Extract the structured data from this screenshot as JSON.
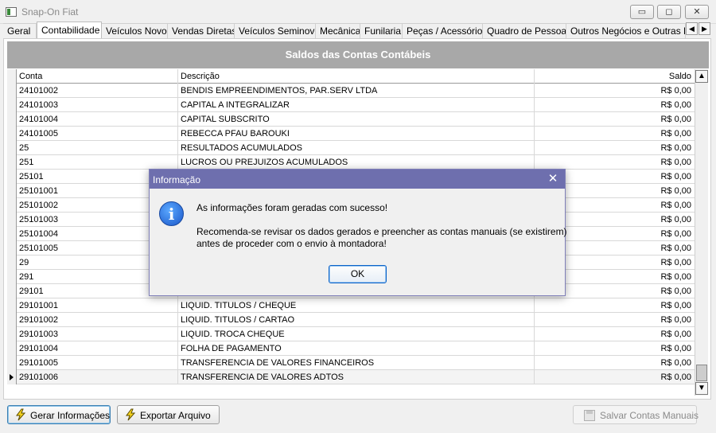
{
  "window": {
    "title": "Snap-On Fiat",
    "minimize_label": "▭",
    "maximize_label": "◻",
    "close_label": "✕"
  },
  "tabs": [
    {
      "label": "Geral"
    },
    {
      "label": "Contabilidade"
    },
    {
      "label": "Veículos Novos"
    },
    {
      "label": "Vendas Diretas"
    },
    {
      "label": "Veículos Seminovos"
    },
    {
      "label": "Mecânica"
    },
    {
      "label": "Funilaria"
    },
    {
      "label": "Peças / Acessórios"
    },
    {
      "label": "Quadro de Pessoas"
    },
    {
      "label": "Outros Negócios e Outras Mar"
    }
  ],
  "tab_scroll": {
    "left": "◀",
    "right": "▶"
  },
  "grid": {
    "title": "Saldos das Contas Contábeis",
    "columns": {
      "conta": "Conta",
      "descricao": "Descrição",
      "saldo": "Saldo"
    },
    "rows": [
      {
        "conta": "24101002",
        "descricao": "BENDIS EMPREENDIMENTOS, PAR.SERV LTDA",
        "saldo": "R$ 0,00"
      },
      {
        "conta": "24101003",
        "descricao": "CAPITAL A INTEGRALIZAR",
        "saldo": "R$ 0,00"
      },
      {
        "conta": "24101004",
        "descricao": "CAPITAL SUBSCRITO",
        "saldo": "R$ 0,00"
      },
      {
        "conta": "24101005",
        "descricao": "REBECCA PFAU BAROUKI",
        "saldo": "R$ 0,00"
      },
      {
        "conta": "25",
        "descricao": "RESULTADOS ACUMULADOS",
        "saldo": "R$ 0,00"
      },
      {
        "conta": "251",
        "descricao": "LUCROS OU PREJUIZOS ACUMULADOS",
        "saldo": "R$ 0,00"
      },
      {
        "conta": "25101",
        "descricao": "",
        "saldo": "R$ 0,00"
      },
      {
        "conta": "25101001",
        "descricao": "",
        "saldo": "R$ 0,00"
      },
      {
        "conta": "25101002",
        "descricao": "",
        "saldo": "R$ 0,00"
      },
      {
        "conta": "25101003",
        "descricao": "",
        "saldo": "R$ 0,00"
      },
      {
        "conta": "25101004",
        "descricao": "",
        "saldo": "R$ 0,00"
      },
      {
        "conta": "25101005",
        "descricao": "",
        "saldo": "R$ 0,00"
      },
      {
        "conta": "29",
        "descricao": "",
        "saldo": "R$ 0,00"
      },
      {
        "conta": "291",
        "descricao": "",
        "saldo": "R$ 0,00"
      },
      {
        "conta": "29101",
        "descricao": "",
        "saldo": "R$ 0,00"
      },
      {
        "conta": "29101001",
        "descricao": "LIQUID. TITULOS / CHEQUE",
        "saldo": "R$ 0,00"
      },
      {
        "conta": "29101002",
        "descricao": "LIQUID. TITULOS / CARTAO",
        "saldo": "R$ 0,00"
      },
      {
        "conta": "29101003",
        "descricao": "LIQUID. TROCA CHEQUE",
        "saldo": "R$ 0,00"
      },
      {
        "conta": "29101004",
        "descricao": "FOLHA DE PAGAMENTO",
        "saldo": "R$ 0,00"
      },
      {
        "conta": "29101005",
        "descricao": "TRANSFERENCIA DE VALORES FINANCEIROS",
        "saldo": "R$ 0,00"
      },
      {
        "conta": "29101006",
        "descricao": "TRANSFERENCIA DE VALORES ADTOS",
        "saldo": "R$ 0,00",
        "current": true
      }
    ]
  },
  "scrollbar": {
    "up": "▲",
    "down": "▼"
  },
  "buttons": {
    "gerar": "Gerar Informações",
    "exportar": "Exportar Arquivo",
    "salvar": "Salvar Contas Manuais"
  },
  "dialog": {
    "title": "Informação",
    "close_label": "✕",
    "icon": "i",
    "message_line1": "As informações foram geradas com sucesso!",
    "message_line2": "Recomenda-se revisar os dados gerados e preencher as contas manuais (se existirem)",
    "message_line3": "antes de proceder com o envio à montadora!",
    "ok_label": "OK"
  },
  "colors": {
    "dialog_title_bg": "#6e6fae",
    "grid_title_bg": "#a8a8a8",
    "bolt_yellow": "#f7d51e"
  }
}
